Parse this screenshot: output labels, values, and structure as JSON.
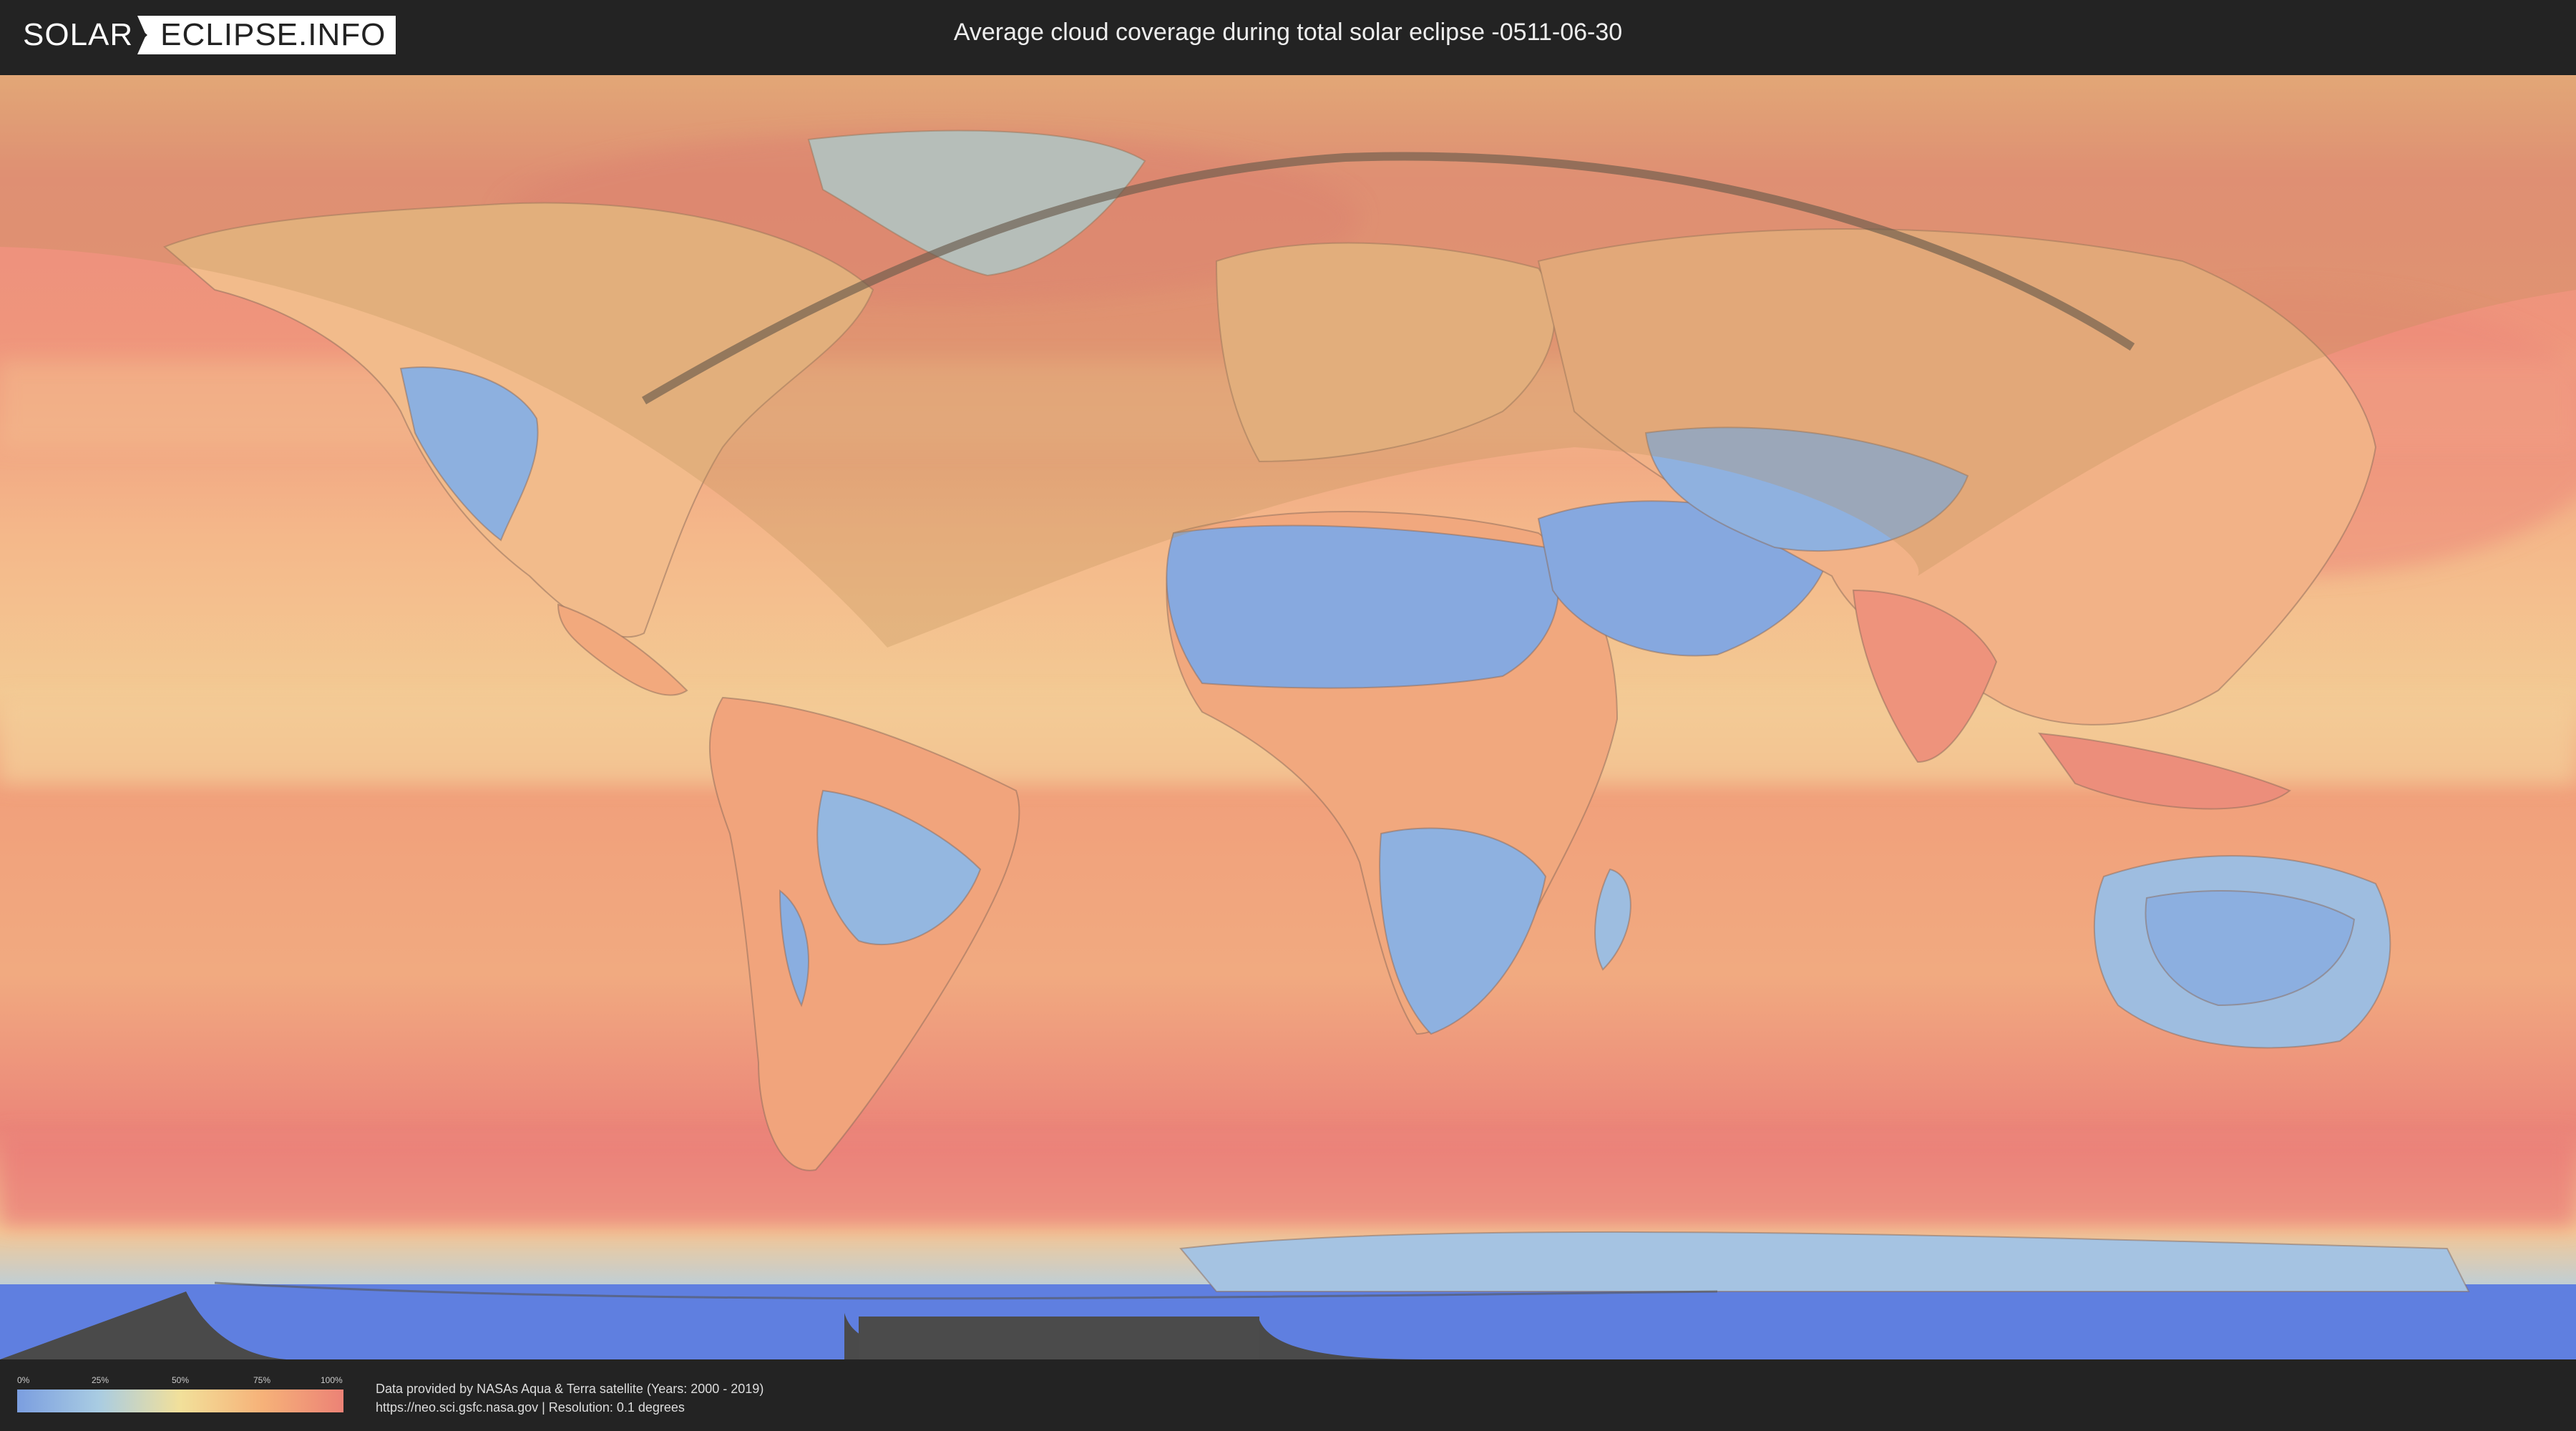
{
  "header": {
    "logo_left": "SOLAR",
    "logo_right": "ECLIPSE.INFO",
    "title": "Average cloud coverage during total solar eclipse -0511-06-30"
  },
  "legend": {
    "ticks": [
      "0%",
      "25%",
      "50%",
      "75%",
      "100%"
    ],
    "colors": [
      "#7b9ee0",
      "#a9cce2",
      "#f2e09a",
      "#f6b279",
      "#ec8276"
    ]
  },
  "credits": {
    "line1": "Data provided by NASAs Aqua & Terra satellite (Years: 2000 - 2019)",
    "line2": "https://neo.sci.gsfc.nasa.gov | Resolution: 0.1 degrees"
  },
  "icons": {
    "logo_separator": "sun-burst-icon"
  }
}
